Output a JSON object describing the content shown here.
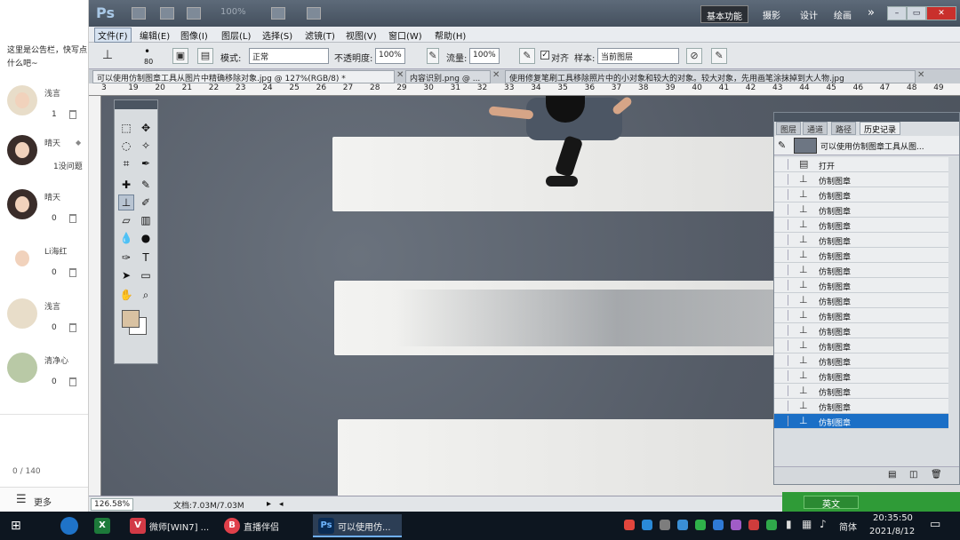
{
  "left_panel": {
    "notice": "这里是公告栏，快写点什么吧~",
    "users": [
      {
        "name": "浅言",
        "count": "1"
      },
      {
        "name": "晴天",
        "count": "1没问题"
      },
      {
        "name": "晴天",
        "count": "0"
      },
      {
        "name": "Li海红",
        "count": "0"
      },
      {
        "name": "浅言",
        "count": "0"
      },
      {
        "name": "清净心",
        "count": "0"
      }
    ],
    "char_counter": "0 / 140",
    "more_label": "更多"
  },
  "ps": {
    "logo": "Ps",
    "zoom_display": "100%",
    "workspaces": [
      "基本功能",
      "摄影",
      "设计",
      "绘画"
    ],
    "more_ws": "»",
    "menu": [
      "文件(F)",
      "编辑(E)",
      "图像(I)",
      "图层(L)",
      "选择(S)",
      "滤镜(T)",
      "视图(V)",
      "窗口(W)",
      "帮助(H)"
    ],
    "options": {
      "brush_size": "80",
      "mode_label": "模式:",
      "mode_value": "正常",
      "opacity_label": "不透明度:",
      "opacity_value": "100%",
      "flow_label": "流量:",
      "flow_value": "100%",
      "align_label": "对齐",
      "sample_label": "样本:",
      "sample_value": "当前图层"
    },
    "tabs": [
      "可以使用仿制图章工具从图片中精确移除对象.jpg @ 127%(RGB/8) *",
      "内容识别.png @ ...",
      "使用修复笔刷工具移除照片中的小对象和较大的对象。较大对象，先用画笔涂抹掉到大人物.jpg"
    ],
    "ruler_numbers": [
      "3",
      "19",
      "20",
      "21",
      "22",
      "23",
      "24",
      "25",
      "26",
      "27",
      "28",
      "29",
      "30",
      "31",
      "32",
      "33",
      "34",
      "35",
      "36",
      "37",
      "38",
      "39",
      "40",
      "41",
      "42",
      "43",
      "44",
      "45",
      "46",
      "47",
      "48",
      "49"
    ],
    "history": {
      "tabs": [
        "图层",
        "通道",
        "路径",
        "历史记录"
      ],
      "source_label": "可以使用仿制图章工具从图...",
      "rows": [
        "打开",
        "仿制图章",
        "仿制图章",
        "仿制图章",
        "仿制图章",
        "仿制图章",
        "仿制图章",
        "仿制图章",
        "仿制图章",
        "仿制图章",
        "仿制图章",
        "仿制图章",
        "仿制图章",
        "仿制图章",
        "仿制图章",
        "仿制图章",
        "仿制图章",
        "仿制图章"
      ]
    },
    "status": {
      "zoom": "126.58%",
      "doc": "文档:7.03M/7.03M"
    }
  },
  "ime": {
    "label": "英文"
  },
  "taskbar": {
    "apps": [
      {
        "icon": "X",
        "label": ""
      },
      {
        "icon": "V",
        "label": "微师[WIN7] ..."
      },
      {
        "icon": "B",
        "label": "直播伴侣"
      },
      {
        "icon": "Ps",
        "label": "可以使用仿..."
      }
    ],
    "lang": "简体",
    "time": "20:35:50",
    "date": "2021/8/12"
  },
  "colors": {
    "selection": "#1b6fc6",
    "ps_title": "#44505e",
    "taskbar": "#0d1620",
    "foreground_swatch": "#d9c2a2"
  }
}
